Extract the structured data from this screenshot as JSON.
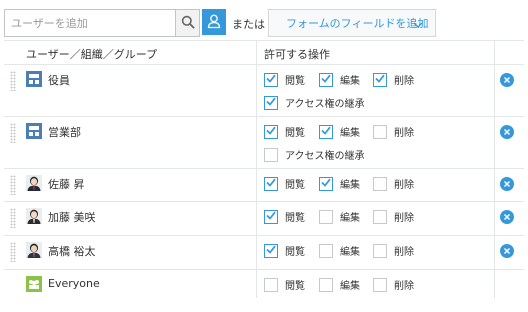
{
  "toolbar": {
    "search_placeholder": "ユーザーを追加",
    "or_text": "または",
    "field_button_label": "フォームのフィールドを追加"
  },
  "table": {
    "headers": {
      "entity": "ユーザー／組織／グループ",
      "permissions": "許可する操作"
    },
    "perm_labels": {
      "view": "閲覧",
      "edit": "編集",
      "delete": "削除",
      "inherit": "アクセス権の継承"
    },
    "rows": [
      {
        "name": "役員",
        "type": "organization",
        "view": true,
        "edit": true,
        "delete": true,
        "inherit": true,
        "removable": true
      },
      {
        "name": "営業部",
        "type": "organization",
        "view": true,
        "edit": true,
        "delete": false,
        "inherit": false,
        "removable": true
      },
      {
        "name": "佐藤 昇",
        "type": "user",
        "view": true,
        "edit": true,
        "delete": false,
        "removable": true
      },
      {
        "name": "加藤 美咲",
        "type": "user",
        "view": true,
        "edit": false,
        "delete": false,
        "removable": true
      },
      {
        "name": "高橋 裕太",
        "type": "user",
        "view": true,
        "edit": false,
        "delete": false,
        "removable": true
      },
      {
        "name": "Everyone",
        "type": "group",
        "view": false,
        "edit": false,
        "delete": false,
        "removable": false
      }
    ]
  },
  "colors": {
    "accent": "#3498db",
    "org_icon": "#4a7fb5",
    "group_icon": "#8bc34a",
    "border": "#e3e7e8"
  }
}
